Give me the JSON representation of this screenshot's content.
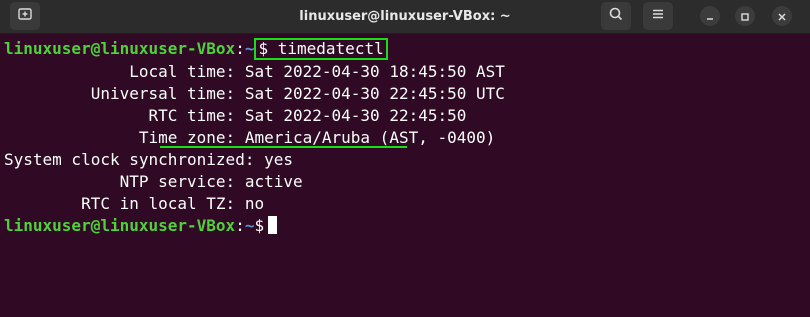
{
  "window": {
    "title": "linuxuser@linuxuser-VBox: ~",
    "new_tab_icon": "new-tab-icon",
    "search_icon": "search-icon",
    "menu_icon": "hamburger-menu-icon",
    "minimize_icon": "minimize-icon",
    "maximize_icon": "maximize-icon",
    "close_icon": "close-icon"
  },
  "colors": {
    "background": "#300a24",
    "prompt_user": "#4fd13a",
    "prompt_path": "#5a8fd8",
    "highlight": "#19dd19"
  },
  "terminal": {
    "prompt": {
      "user_host": "linuxuser@linuxuser-VBox",
      "separator": ":",
      "path": "~",
      "symbol": "$"
    },
    "command": "timedatectl",
    "output": [
      "             Local time: Sat 2022-04-30 18:45:50 AST",
      "         Universal time: Sat 2022-04-30 22:45:50 UTC",
      "               RTC time: Sat 2022-04-30 22:45:50",
      "              Time zone: America/Aruba (AST, -0400)",
      "System clock synchronized: yes",
      "            NTP service: active",
      "        RTC in local TZ: no"
    ]
  }
}
